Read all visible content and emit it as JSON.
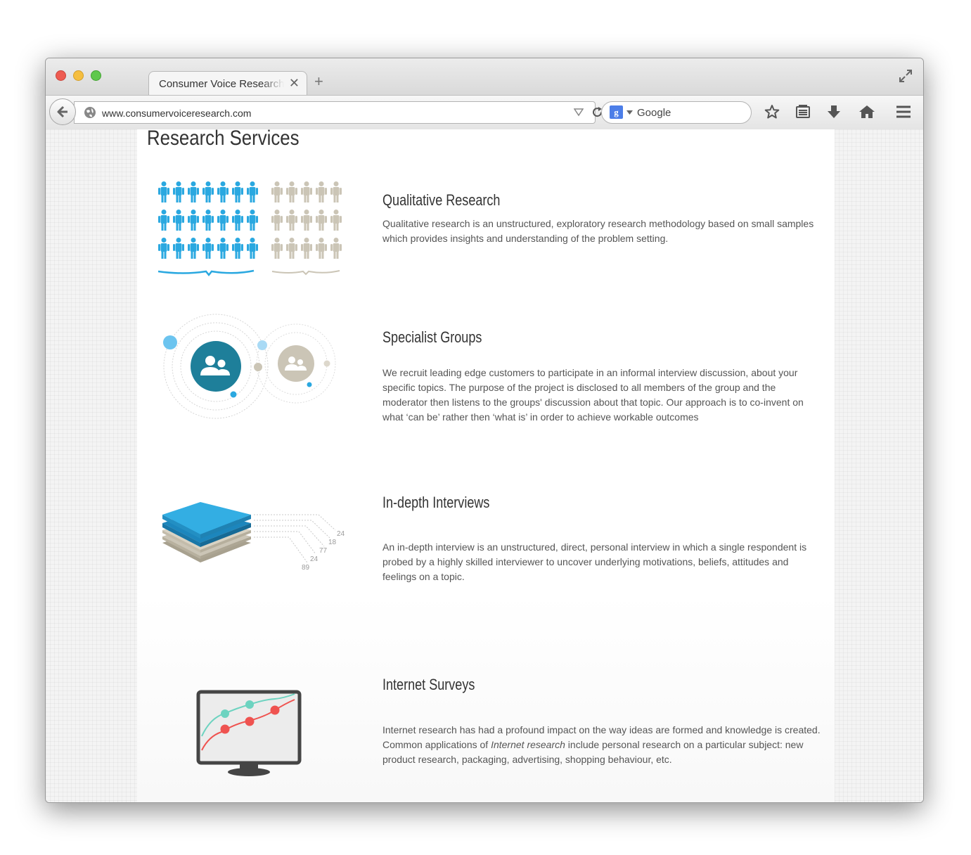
{
  "browser": {
    "tab_title": "Consumer Voice Research",
    "tab_close": "✕",
    "new_tab": "+",
    "url": "www.consumervoiceresearch.com",
    "search_engine_badge": "g",
    "search_placeholder": "Google"
  },
  "page": {
    "title": "Research Services",
    "services": [
      {
        "title": "Qualitative Research",
        "description": "Qualitative research is an unstructured, exploratory research methodology based on small samples which provides insights and understanding of the problem setting.",
        "icon": "people-groups-icon"
      },
      {
        "title": "Specialist Groups",
        "description": "We recruit leading edge customers to participate in an informal interview discussion, about your specific topics. The purpose of the project is disclosed to all members of the group and the moderator then listens to the groups' discussion about that topic. Our approach is to co-invent on what ‘can be’ rather then ‘what is’ in order to achieve workable outcomes",
        "icon": "group-orbits-icon"
      },
      {
        "title": "In-depth Interviews",
        "description": "An in-depth interview is an unstructured, direct, personal interview in which a single respondent is probed by a highly skilled interviewer to uncover underlying motivations, beliefs, attitudes and feelings on a topic.",
        "icon": "layer-stack-icon",
        "layer_labels": [
          "24",
          "18",
          "77",
          "24",
          "89"
        ]
      },
      {
        "title": "Internet Surveys",
        "description_before": "Internet research has had a profound impact on the way ideas are formed and knowledge is created. Common applications of ",
        "description_emphasis": "Internet research",
        "description_after": " include personal research on a particular subject: new product research, packaging, advertising, shopping behaviour,  etc.",
        "icon": "monitor-chart-icon"
      }
    ]
  },
  "colors": {
    "accent_blue": "#2aa8e0",
    "accent_teal": "#1e7f9a",
    "neutral_beige": "#c9c2b2",
    "chart_red": "#ef5350",
    "chart_teal": "#6dd3c0"
  }
}
